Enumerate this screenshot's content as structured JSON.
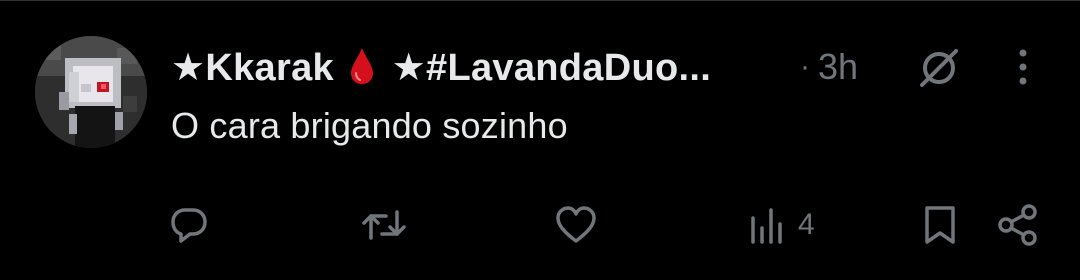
{
  "tweet": {
    "name_part_1": "★Kkarak",
    "name_part_2": "★#LavandaDuo...",
    "time_dot": "·",
    "time": "3h",
    "text": "O cara brigando sozinho"
  },
  "actions": {
    "reply_count": "",
    "retweet_count": "",
    "like_count": "",
    "views_count": "4"
  },
  "colors": {
    "background": "#000000",
    "text_primary": "#e7e9ea",
    "text_secondary": "#71767b",
    "blood_drop": "#d3101c"
  },
  "icons": {
    "name_emoji": "blood-drop-icon",
    "grok": "grok-icon",
    "more": "more-vertical-icon",
    "reply": "reply-icon",
    "retweet": "retweet-icon",
    "like": "heart-icon",
    "views": "analytics-icon",
    "bookmark": "bookmark-icon",
    "share": "share-icon"
  }
}
